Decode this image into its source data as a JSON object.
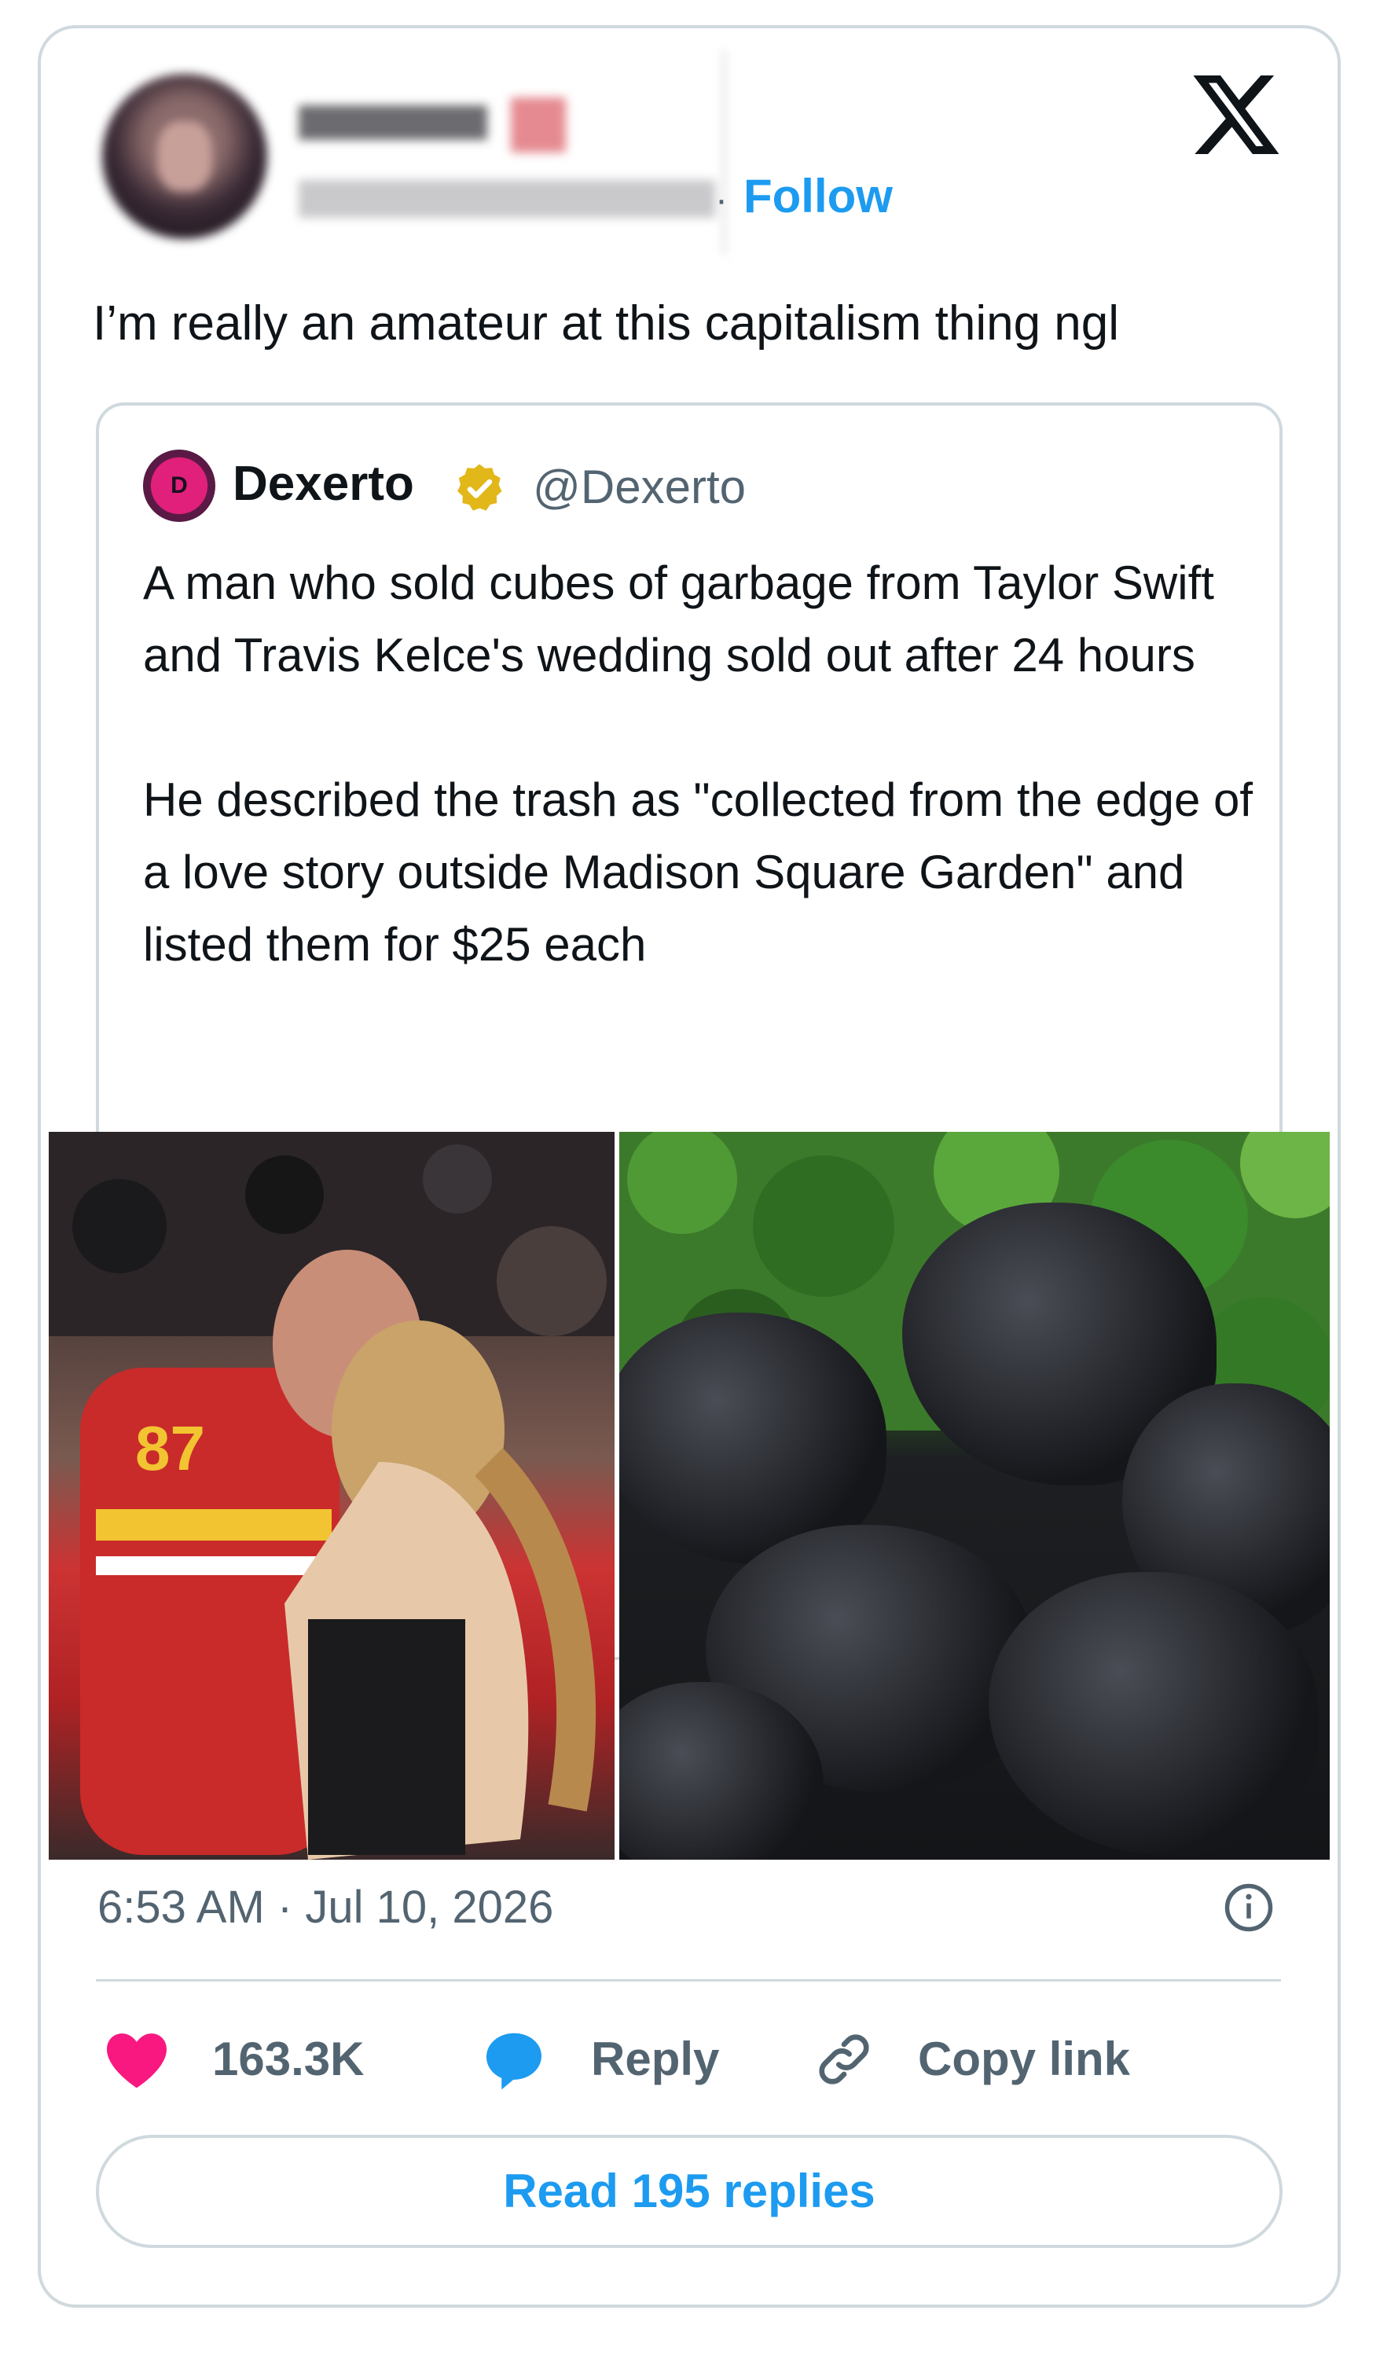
{
  "author": {
    "name": "",
    "handle": "",
    "follow_label": "Follow",
    "separator": "·"
  },
  "brand": {
    "logo": "x-logo-icon"
  },
  "tweet": {
    "text": "I’m really an amateur at this capitalism thing ngl"
  },
  "quote": {
    "avatar_initials": "D",
    "name": "Dexerto",
    "verified_badge": "gold-verified-badge-icon",
    "handle": "@Dexerto",
    "paragraph_1": "A man who sold cubes of garbage from Taylor Swift and Travis Kelce's wedding sold out after 24 hours",
    "paragraph_2": "He described the trash as \"collected from the edge of a love story outside Madison Square Garden\" and listed them for $25 each"
  },
  "media": {
    "left_alt": "photo-couple-kissing",
    "right_alt": "photo-garbage-bags",
    "jersey_number": "87"
  },
  "meta": {
    "timestamp": "6:53 AM · Jul 10, 2026",
    "info_icon": "info-icon"
  },
  "actions": {
    "like_count": "163.3K",
    "reply_label": "Reply",
    "copy_link_label": "Copy link"
  },
  "footer": {
    "read_replies_label": "Read 195 replies"
  },
  "colors": {
    "accent": "#1d9bf0",
    "heart": "#f91880",
    "muted_text": "#536471",
    "border": "#cfd9de",
    "verified_gold": "#e2b719"
  }
}
